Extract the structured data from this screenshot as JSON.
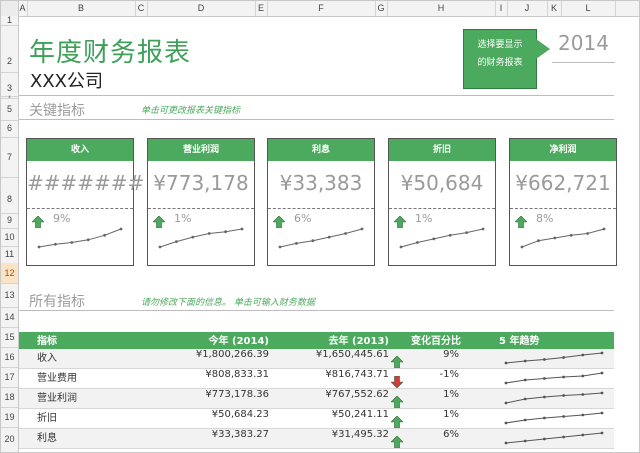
{
  "columns": [
    "A",
    "B",
    "C",
    "D",
    "E",
    "F",
    "G",
    "H",
    "I",
    "J",
    "K",
    "L"
  ],
  "rows": [
    "1",
    "2",
    "3",
    "4",
    "5",
    "6",
    "7",
    "8",
    "9",
    "10",
    "11",
    "12",
    "13",
    "14",
    "15",
    "16",
    "17",
    "18",
    "19",
    "20"
  ],
  "selected_row": "12",
  "title": "年度财务报表",
  "company": "XXX公司",
  "callout": {
    "line1": "选择要显示",
    "line2": "的财务报表"
  },
  "year": "2014",
  "key_section": {
    "title": "关键指标",
    "hint": "单击可更改报表关键指标"
  },
  "all_section": {
    "title": "所有指标",
    "hint": "请勿修改下面的信息。 单击可输入财务数据"
  },
  "cards": [
    {
      "label": "收入",
      "value": "#######",
      "pct": "9%",
      "dir": "up",
      "trend": [
        0.0,
        0.15,
        0.25,
        0.4,
        0.65,
        1.0
      ]
    },
    {
      "label": "营业利润",
      "value": "¥773,178",
      "pct": "1%",
      "dir": "up",
      "trend": [
        0.0,
        0.3,
        0.55,
        0.75,
        0.85,
        1.0
      ]
    },
    {
      "label": "利息",
      "value": "¥33,383",
      "pct": "6%",
      "dir": "up",
      "trend": [
        0.0,
        0.2,
        0.35,
        0.55,
        0.75,
        1.0
      ]
    },
    {
      "label": "折旧",
      "value": "¥50,684",
      "pct": "1%",
      "dir": "up",
      "trend": [
        0.0,
        0.25,
        0.45,
        0.65,
        0.8,
        1.0
      ]
    },
    {
      "label": "净利润",
      "value": "¥662,721",
      "pct": "8%",
      "dir": "up",
      "trend": [
        0.0,
        0.35,
        0.5,
        0.65,
        0.75,
        1.0
      ]
    }
  ],
  "table": {
    "headers": [
      "指标",
      "今年 (2014)",
      "去年 (2013)",
      "变化百分比",
      "5 年趋势"
    ],
    "rows": [
      {
        "name": "收入",
        "this_year": "¥1,800,266.39",
        "last_year": "¥1,650,445.61",
        "dir": "up",
        "pct": "9%",
        "trend": [
          0.0,
          0.2,
          0.35,
          0.55,
          0.8,
          1.0
        ]
      },
      {
        "name": "营业费用",
        "this_year": "¥808,833.31",
        "last_year": "¥816,743.71",
        "dir": "down",
        "pct": "-1%",
        "trend": [
          0.0,
          0.3,
          0.45,
          0.6,
          0.7,
          1.0
        ]
      },
      {
        "name": "营业利润",
        "this_year": "¥773,178.36",
        "last_year": "¥767,552.62",
        "dir": "up",
        "pct": "1%",
        "trend": [
          0.0,
          0.4,
          0.6,
          0.75,
          0.85,
          1.0
        ]
      },
      {
        "name": "折旧",
        "this_year": "¥50,684.23",
        "last_year": "¥50,241.11",
        "dir": "up",
        "pct": "1%",
        "trend": [
          0.0,
          0.3,
          0.5,
          0.65,
          0.8,
          1.0
        ]
      },
      {
        "name": "利息",
        "this_year": "¥33,383.27",
        "last_year": "¥31,495.32",
        "dir": "up",
        "pct": "6%",
        "trend": [
          0.0,
          0.2,
          0.4,
          0.6,
          0.8,
          1.0
        ]
      }
    ]
  },
  "colors": {
    "accent": "#4caa5e",
    "up": "#4caa5e",
    "down": "#d23b3b",
    "muted": "#9a9a9a"
  }
}
